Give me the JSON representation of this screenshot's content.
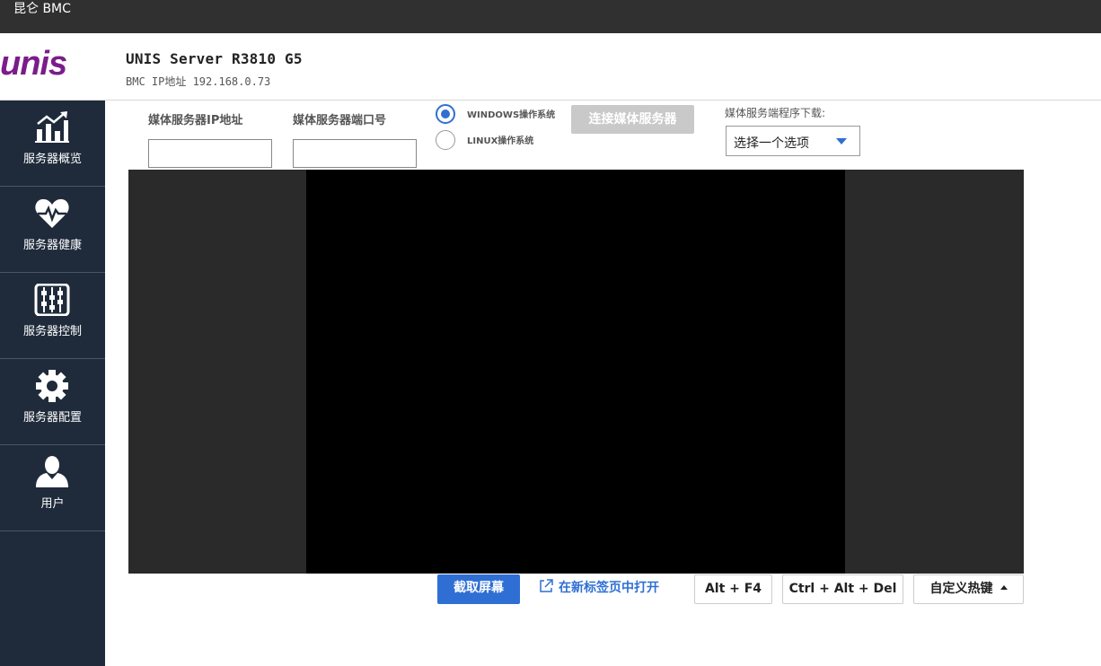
{
  "topbar": {
    "title": "昆仑 BMC"
  },
  "header": {
    "logo_text": "unis",
    "server_name": "UNIS Server R3810 G5",
    "bmc_ip": "BMC IP地址 192.168.0.73",
    "brand_color": "#7b1c8a"
  },
  "sidebar": {
    "items": [
      {
        "label": "服务器概览",
        "icon": "chart-icon"
      },
      {
        "label": "服务器健康",
        "icon": "heart-pulse-icon"
      },
      {
        "label": "服务器控制",
        "icon": "abacus-icon"
      },
      {
        "label": "服务器配置",
        "icon": "gear-icon"
      },
      {
        "label": "用户",
        "icon": "user-icon"
      }
    ]
  },
  "media": {
    "ip_label": "媒体服务器IP地址",
    "ip_value": "",
    "port_label": "媒体服务器端口号",
    "port_value": "",
    "os_windows": "WINDOWS操作系统",
    "os_linux": "LINUX操作系统",
    "selected_os": "windows",
    "connect_label": "连接媒体服务器",
    "download_label": "媒体服务端程序下载:",
    "select_value": "选择一个选项"
  },
  "actions": {
    "capture": "截取屏幕",
    "open_new_tab": "在新标签页中打开",
    "alt_f4": "Alt + F4",
    "ctrl_alt_del": "Ctrl + Alt + Del",
    "custom_hotkey": "自定义热键"
  },
  "colors": {
    "accent": "#2f6fd4",
    "sidebar_bg": "#1f2b3b",
    "topbar_bg": "#303030"
  }
}
